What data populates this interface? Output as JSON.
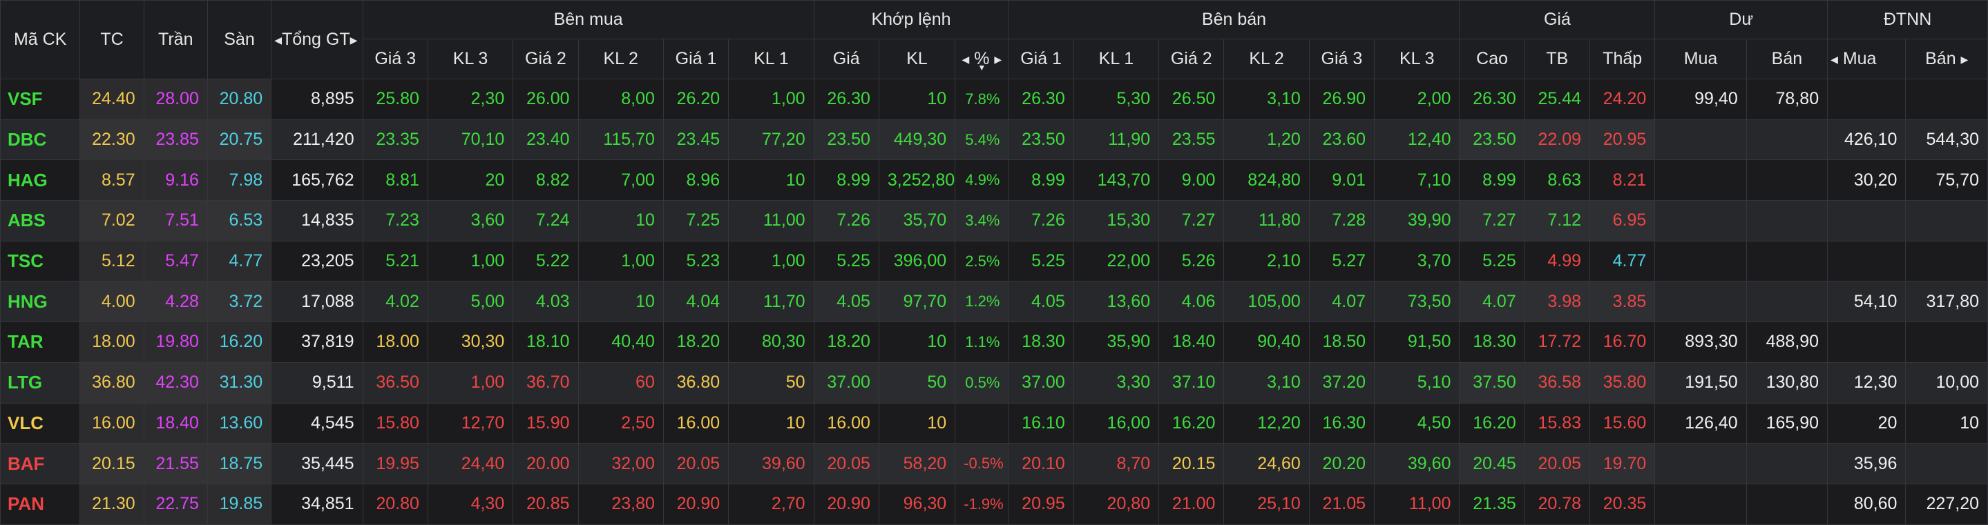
{
  "colors": {
    "ref": "#f2c94c",
    "ceil": "#e040fb",
    "floor": "#4dd0e1",
    "up": "#3ddc3d",
    "down": "#ef4444",
    "neutral": "#f0f0f0",
    "header_bg": "#1d1e21",
    "row_bg": "#1b1b1d",
    "row_alt_bg": "#27282b"
  },
  "headers": {
    "symbol": "Mã CK",
    "ref": "TC",
    "ceil": "Trần",
    "floor": "Sàn",
    "total": "Tổng GT",
    "buy_group": "Bên mua",
    "match_group": "Khớp lệnh",
    "sell_group": "Bên bán",
    "price_group": "Giá",
    "remain_group": "Dư",
    "foreign_group": "ĐTNN",
    "buy": [
      "Giá 3",
      "KL 3",
      "Giá 2",
      "KL 2",
      "Giá 1",
      "KL 1"
    ],
    "match": [
      "Giá",
      "KL",
      "%"
    ],
    "sell": [
      "Giá 1",
      "KL 1",
      "Giá 2",
      "KL 2",
      "Giá 3",
      "KL 3"
    ],
    "price": [
      "Cao",
      "TB",
      "Thấp"
    ],
    "remain": [
      "Mua",
      "Bán"
    ],
    "foreign": [
      "Mua",
      "Bán"
    ]
  },
  "rows": [
    {
      "symbol": "VSF",
      "s": "u",
      "ref": "24.40",
      "ceil": "28.00",
      "floor": "20.80",
      "total": "8,895",
      "buy": [
        [
          "25.80",
          "u"
        ],
        [
          "2,30",
          "u"
        ],
        [
          "26.00",
          "u"
        ],
        [
          "8,00",
          "u"
        ],
        [
          "26.20",
          "u"
        ],
        [
          "1,00",
          "u"
        ]
      ],
      "match": [
        [
          "26.30",
          "u"
        ],
        [
          "10",
          "u"
        ],
        [
          "7.8%",
          "u"
        ]
      ],
      "sell": [
        [
          "26.30",
          "u"
        ],
        [
          "5,30",
          "u"
        ],
        [
          "26.50",
          "u"
        ],
        [
          "3,10",
          "u"
        ],
        [
          "26.90",
          "u"
        ],
        [
          "2,00",
          "u"
        ]
      ],
      "price": [
        [
          "26.30",
          "u"
        ],
        [
          "25.44",
          "u"
        ],
        [
          "24.20",
          "d"
        ]
      ],
      "remain": [
        "99,40",
        "78,80"
      ],
      "foreign": [
        "",
        ""
      ]
    },
    {
      "symbol": "DBC",
      "s": "u",
      "ref": "22.30",
      "ceil": "23.85",
      "floor": "20.75",
      "total": "211,420",
      "buy": [
        [
          "23.35",
          "u"
        ],
        [
          "70,10",
          "u"
        ],
        [
          "23.40",
          "u"
        ],
        [
          "115,70",
          "u"
        ],
        [
          "23.45",
          "u"
        ],
        [
          "77,20",
          "u"
        ]
      ],
      "match": [
        [
          "23.50",
          "u"
        ],
        [
          "449,30",
          "u"
        ],
        [
          "5.4%",
          "u"
        ]
      ],
      "sell": [
        [
          "23.50",
          "u"
        ],
        [
          "11,90",
          "u"
        ],
        [
          "23.55",
          "u"
        ],
        [
          "1,20",
          "u"
        ],
        [
          "23.60",
          "u"
        ],
        [
          "12,40",
          "u"
        ]
      ],
      "price": [
        [
          "23.50",
          "u"
        ],
        [
          "22.09",
          "d"
        ],
        [
          "20.95",
          "d"
        ]
      ],
      "remain": [
        "",
        ""
      ],
      "foreign": [
        "426,10",
        "544,30"
      ]
    },
    {
      "symbol": "HAG",
      "s": "u",
      "ref": "8.57",
      "ceil": "9.16",
      "floor": "7.98",
      "total": "165,762",
      "buy": [
        [
          "8.81",
          "u"
        ],
        [
          "20",
          "u"
        ],
        [
          "8.82",
          "u"
        ],
        [
          "7,00",
          "u"
        ],
        [
          "8.96",
          "u"
        ],
        [
          "10",
          "u"
        ]
      ],
      "match": [
        [
          "8.99",
          "u"
        ],
        [
          "3,252,80",
          "u"
        ],
        [
          "4.9%",
          "u"
        ]
      ],
      "sell": [
        [
          "8.99",
          "u"
        ],
        [
          "143,70",
          "u"
        ],
        [
          "9.00",
          "u"
        ],
        [
          "824,80",
          "u"
        ],
        [
          "9.01",
          "u"
        ],
        [
          "7,10",
          "u"
        ]
      ],
      "price": [
        [
          "8.99",
          "u"
        ],
        [
          "8.63",
          "u"
        ],
        [
          "8.21",
          "d"
        ]
      ],
      "remain": [
        "",
        ""
      ],
      "foreign": [
        "30,20",
        "75,70"
      ]
    },
    {
      "symbol": "ABS",
      "s": "u",
      "ref": "7.02",
      "ceil": "7.51",
      "floor": "6.53",
      "total": "14,835",
      "buy": [
        [
          "7.23",
          "u"
        ],
        [
          "3,60",
          "u"
        ],
        [
          "7.24",
          "u"
        ],
        [
          "10",
          "u"
        ],
        [
          "7.25",
          "u"
        ],
        [
          "11,00",
          "u"
        ]
      ],
      "match": [
        [
          "7.26",
          "u"
        ],
        [
          "35,70",
          "u"
        ],
        [
          "3.4%",
          "u"
        ]
      ],
      "sell": [
        [
          "7.26",
          "u"
        ],
        [
          "15,30",
          "u"
        ],
        [
          "7.27",
          "u"
        ],
        [
          "11,80",
          "u"
        ],
        [
          "7.28",
          "u"
        ],
        [
          "39,90",
          "u"
        ]
      ],
      "price": [
        [
          "7.27",
          "u"
        ],
        [
          "7.12",
          "u"
        ],
        [
          "6.95",
          "d"
        ]
      ],
      "remain": [
        "",
        ""
      ],
      "foreign": [
        "",
        ""
      ]
    },
    {
      "symbol": "TSC",
      "s": "u",
      "ref": "5.12",
      "ceil": "5.47",
      "floor": "4.77",
      "total": "23,205",
      "buy": [
        [
          "5.21",
          "u"
        ],
        [
          "1,00",
          "u"
        ],
        [
          "5.22",
          "u"
        ],
        [
          "1,00",
          "u"
        ],
        [
          "5.23",
          "u"
        ],
        [
          "1,00",
          "u"
        ]
      ],
      "match": [
        [
          "5.25",
          "u"
        ],
        [
          "396,00",
          "u"
        ],
        [
          "2.5%",
          "u"
        ]
      ],
      "sell": [
        [
          "5.25",
          "u"
        ],
        [
          "22,00",
          "u"
        ],
        [
          "5.26",
          "u"
        ],
        [
          "2,10",
          "u"
        ],
        [
          "5.27",
          "u"
        ],
        [
          "3,70",
          "u"
        ]
      ],
      "price": [
        [
          "5.25",
          "u"
        ],
        [
          "4.99",
          "d"
        ],
        [
          "4.77",
          "f"
        ]
      ],
      "remain": [
        "",
        ""
      ],
      "foreign": [
        "",
        ""
      ]
    },
    {
      "symbol": "HNG",
      "s": "u",
      "ref": "4.00",
      "ceil": "4.28",
      "floor": "3.72",
      "total": "17,088",
      "buy": [
        [
          "4.02",
          "u"
        ],
        [
          "5,00",
          "u"
        ],
        [
          "4.03",
          "u"
        ],
        [
          "10",
          "u"
        ],
        [
          "4.04",
          "u"
        ],
        [
          "11,70",
          "u"
        ]
      ],
      "match": [
        [
          "4.05",
          "u"
        ],
        [
          "97,70",
          "u"
        ],
        [
          "1.2%",
          "u"
        ]
      ],
      "sell": [
        [
          "4.05",
          "u"
        ],
        [
          "13,60",
          "u"
        ],
        [
          "4.06",
          "u"
        ],
        [
          "105,00",
          "u"
        ],
        [
          "4.07",
          "u"
        ],
        [
          "73,50",
          "u"
        ]
      ],
      "price": [
        [
          "4.07",
          "u"
        ],
        [
          "3.98",
          "d"
        ],
        [
          "3.85",
          "d"
        ]
      ],
      "remain": [
        "",
        ""
      ],
      "foreign": [
        "54,10",
        "317,80"
      ]
    },
    {
      "symbol": "TAR",
      "s": "u",
      "ref": "18.00",
      "ceil": "19.80",
      "floor": "16.20",
      "total": "37,819",
      "buy": [
        [
          "18.00",
          "r"
        ],
        [
          "30,30",
          "r"
        ],
        [
          "18.10",
          "u"
        ],
        [
          "40,40",
          "u"
        ],
        [
          "18.20",
          "u"
        ],
        [
          "80,30",
          "u"
        ]
      ],
      "match": [
        [
          "18.20",
          "u"
        ],
        [
          "10",
          "u"
        ],
        [
          "1.1%",
          "u"
        ]
      ],
      "sell": [
        [
          "18.30",
          "u"
        ],
        [
          "35,90",
          "u"
        ],
        [
          "18.40",
          "u"
        ],
        [
          "90,40",
          "u"
        ],
        [
          "18.50",
          "u"
        ],
        [
          "91,50",
          "u"
        ]
      ],
      "price": [
        [
          "18.30",
          "u"
        ],
        [
          "17.72",
          "d"
        ],
        [
          "16.70",
          "d"
        ]
      ],
      "remain": [
        "893,30",
        "488,90"
      ],
      "foreign": [
        "",
        ""
      ]
    },
    {
      "symbol": "LTG",
      "s": "u",
      "ref": "36.80",
      "ceil": "42.30",
      "floor": "31.30",
      "total": "9,511",
      "buy": [
        [
          "36.50",
          "d"
        ],
        [
          "1,00",
          "d"
        ],
        [
          "36.70",
          "d"
        ],
        [
          "60",
          "d"
        ],
        [
          "36.80",
          "r"
        ],
        [
          "50",
          "r"
        ]
      ],
      "match": [
        [
          "37.00",
          "u"
        ],
        [
          "50",
          "u"
        ],
        [
          "0.5%",
          "u"
        ]
      ],
      "sell": [
        [
          "37.00",
          "u"
        ],
        [
          "3,30",
          "u"
        ],
        [
          "37.10",
          "u"
        ],
        [
          "3,10",
          "u"
        ],
        [
          "37.20",
          "u"
        ],
        [
          "5,10",
          "u"
        ]
      ],
      "price": [
        [
          "37.50",
          "u"
        ],
        [
          "36.58",
          "d"
        ],
        [
          "35.80",
          "d"
        ]
      ],
      "remain": [
        "191,50",
        "130,80"
      ],
      "foreign": [
        "12,30",
        "10,00"
      ]
    },
    {
      "symbol": "VLC",
      "s": "r",
      "ref": "16.00",
      "ceil": "18.40",
      "floor": "13.60",
      "total": "4,545",
      "buy": [
        [
          "15.80",
          "d"
        ],
        [
          "12,70",
          "d"
        ],
        [
          "15.90",
          "d"
        ],
        [
          "2,50",
          "d"
        ],
        [
          "16.00",
          "r"
        ],
        [
          "10",
          "r"
        ]
      ],
      "match": [
        [
          "16.00",
          "r"
        ],
        [
          "10",
          "r"
        ],
        [
          "",
          "r"
        ]
      ],
      "sell": [
        [
          "16.10",
          "u"
        ],
        [
          "16,00",
          "u"
        ],
        [
          "16.20",
          "u"
        ],
        [
          "12,20",
          "u"
        ],
        [
          "16.30",
          "u"
        ],
        [
          "4,50",
          "u"
        ]
      ],
      "price": [
        [
          "16.20",
          "u"
        ],
        [
          "15.83",
          "d"
        ],
        [
          "15.60",
          "d"
        ]
      ],
      "remain": [
        "126,40",
        "165,90"
      ],
      "foreign": [
        "20",
        "10"
      ]
    },
    {
      "symbol": "BAF",
      "s": "d",
      "ref": "20.15",
      "ceil": "21.55",
      "floor": "18.75",
      "total": "35,445",
      "buy": [
        [
          "19.95",
          "d"
        ],
        [
          "24,40",
          "d"
        ],
        [
          "20.00",
          "d"
        ],
        [
          "32,00",
          "d"
        ],
        [
          "20.05",
          "d"
        ],
        [
          "39,60",
          "d"
        ]
      ],
      "match": [
        [
          "20.05",
          "d"
        ],
        [
          "58,20",
          "d"
        ],
        [
          "-0.5%",
          "d"
        ]
      ],
      "sell": [
        [
          "20.10",
          "d"
        ],
        [
          "8,70",
          "d"
        ],
        [
          "20.15",
          "r"
        ],
        [
          "24,60",
          "r"
        ],
        [
          "20.20",
          "u"
        ],
        [
          "39,60",
          "u"
        ]
      ],
      "price": [
        [
          "20.45",
          "u"
        ],
        [
          "20.05",
          "d"
        ],
        [
          "19.70",
          "d"
        ]
      ],
      "remain": [
        "",
        ""
      ],
      "foreign": [
        "35,96",
        ""
      ]
    },
    {
      "symbol": "PAN",
      "s": "d",
      "ref": "21.30",
      "ceil": "22.75",
      "floor": "19.85",
      "total": "34,851",
      "buy": [
        [
          "20.80",
          "d"
        ],
        [
          "4,30",
          "d"
        ],
        [
          "20.85",
          "d"
        ],
        [
          "23,80",
          "d"
        ],
        [
          "20.90",
          "d"
        ],
        [
          "2,70",
          "d"
        ]
      ],
      "match": [
        [
          "20.90",
          "d"
        ],
        [
          "96,30",
          "d"
        ],
        [
          "-1.9%",
          "d"
        ]
      ],
      "sell": [
        [
          "20.95",
          "d"
        ],
        [
          "20,80",
          "d"
        ],
        [
          "21.00",
          "d"
        ],
        [
          "25,10",
          "d"
        ],
        [
          "21.05",
          "d"
        ],
        [
          "11,00",
          "d"
        ]
      ],
      "price": [
        [
          "21.35",
          "u"
        ],
        [
          "20.78",
          "d"
        ],
        [
          "20.35",
          "d"
        ]
      ],
      "remain": [
        "",
        ""
      ],
      "foreign": [
        "80,60",
        "227,20"
      ]
    }
  ]
}
